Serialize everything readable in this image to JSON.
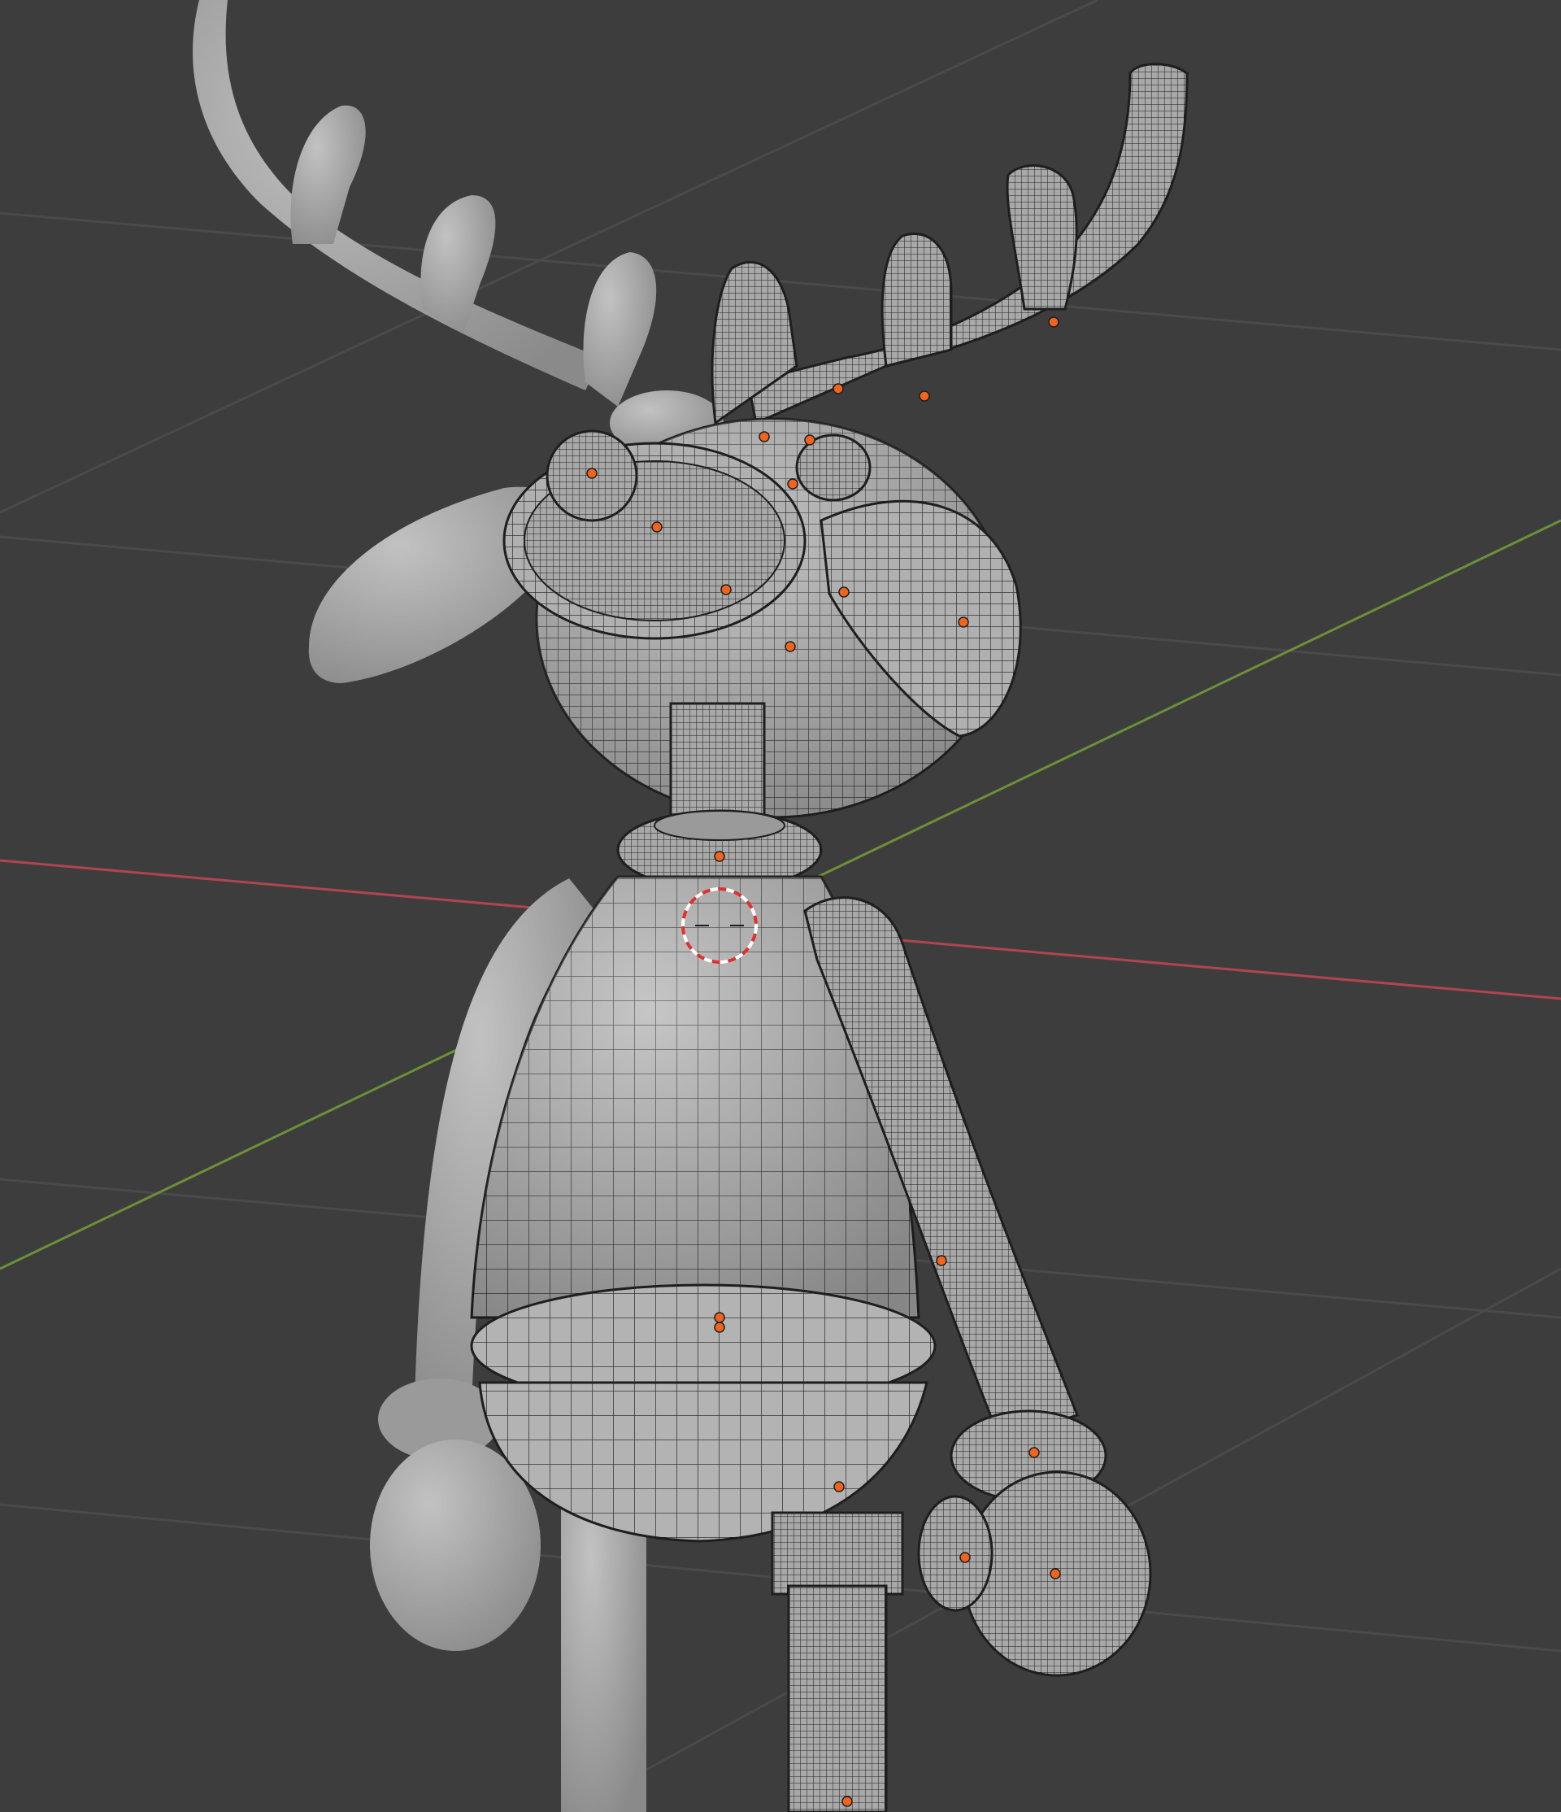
{
  "viewport": {
    "background": "#3d3d3d",
    "grid_color": "#4a4a4a",
    "x_axis_color": "#b04450",
    "y_axis_color": "#6e8f3a"
  },
  "model": {
    "mesh_color": "#a9a9a9",
    "mesh_shadow_color": "#8a8a8a",
    "wire_color": "#1e1e1e",
    "selected_origin_color": "#f0641e"
  },
  "cursor_3d": {
    "ring_colors": [
      "#ffffff",
      "#e03030"
    ]
  }
}
